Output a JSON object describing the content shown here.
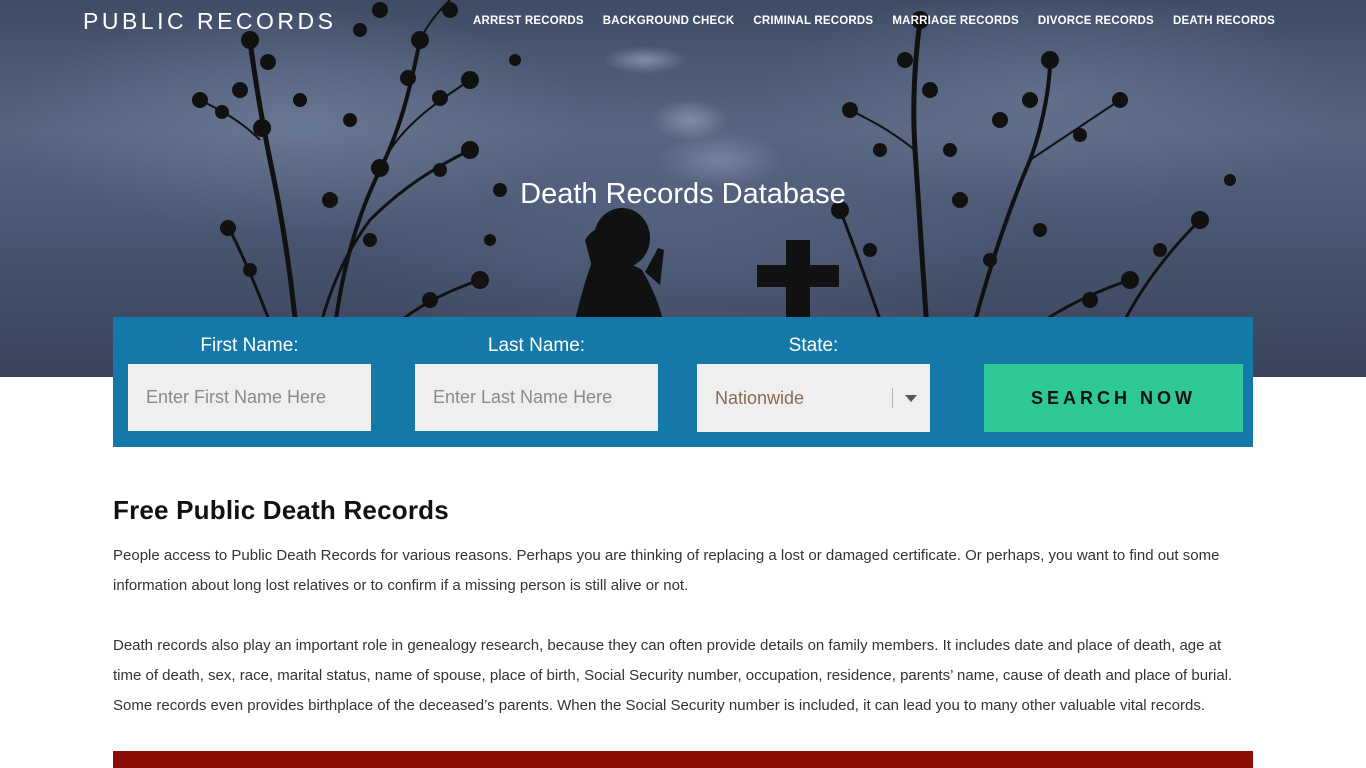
{
  "header": {
    "logo": "PUBLIC RECORDS",
    "nav": [
      "ARREST RECORDS",
      "BACKGROUND CHECK",
      "CRIMINAL RECORDS",
      "MARRIAGE RECORDS",
      "DIVORCE RECORDS",
      "DEATH RECORDS"
    ]
  },
  "hero": {
    "title": "Death Records Database"
  },
  "search": {
    "first_name_label": "First Name:",
    "first_name_placeholder": "Enter First Name Here",
    "last_name_label": "Last Name:",
    "last_name_placeholder": "Enter Last Name Here",
    "state_label": "State:",
    "state_value": "Nationwide",
    "button_label": "SEARCH NOW"
  },
  "content": {
    "heading": "Free Public Death Records",
    "paragraphs": [
      "People access to Public Death Records for various reasons. Perhaps you are thinking of replacing a lost or damaged certificate. Or perhaps, you want to find out some information about long lost relatives or to confirm if a missing person is still alive or not.",
      "Death records also play an important role in genealogy research, because they can often provide details on family members. It includes date and place of death, age at time of death, sex, race, marital status, name of spouse, place of birth, Social Security number, occupation, residence, parents’ name, cause of death and place of burial. Some records even provides birthplace of the deceased’s parents. When the Social Security number is included, it can lead you to many other valuable vital records."
    ]
  },
  "colors": {
    "search_panel": "#1478a8",
    "search_button": "#2ec894",
    "footer_bar": "#8b0d05"
  }
}
